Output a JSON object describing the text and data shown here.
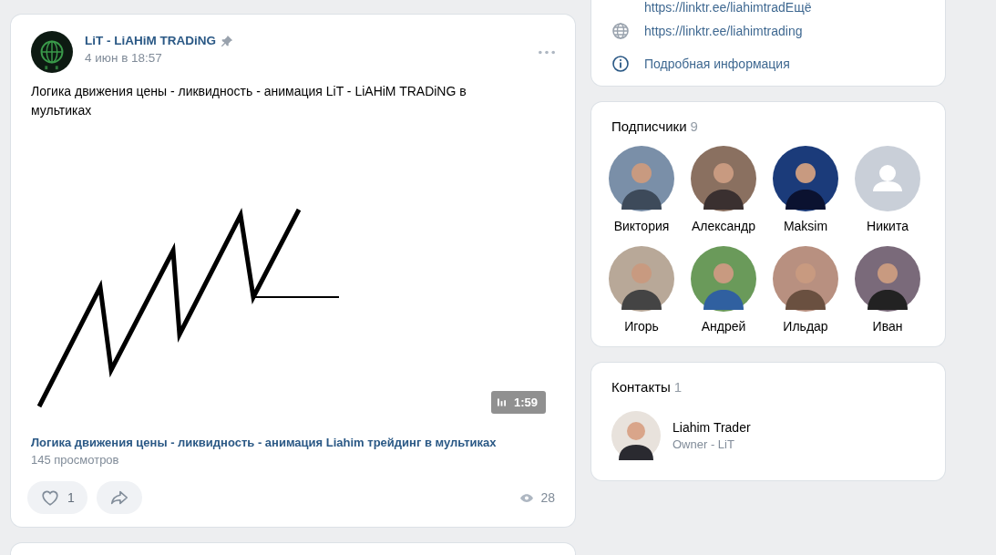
{
  "post": {
    "author": "LiT - LiAHiM TRADiNG",
    "pinned": true,
    "date": "4 июн в 18:57",
    "text": "Логика движения цены - ликвидность - анимация LiT - LiAHiM TRADiNG в мультиках",
    "video": {
      "kind": "picture",
      "duration": "1:59",
      "title": "Логика движения цены - ликвидность - анимация Liahim трейдинг в мультиках",
      "views": "145 просмотров"
    },
    "likes": {
      "count": "1",
      "liked": false
    },
    "view_count": "28"
  },
  "info": {
    "links": [
      {
        "kind": "partial",
        "text": "https://linktr.ee/liahimtradЕщё"
      },
      {
        "kind": "globe",
        "text": "https://linktr.ee/liahimtrading"
      },
      {
        "kind": "info",
        "text": "Подробная информация"
      }
    ]
  },
  "subscribers": {
    "title": "Подписчики",
    "count": "9",
    "people": [
      {
        "name": "Виктория"
      },
      {
        "name": "Александр"
      },
      {
        "name": "Maksim"
      },
      {
        "name": "Никита",
        "kind": "placeholder"
      },
      {
        "name": "Игорь"
      },
      {
        "name": "Андрей"
      },
      {
        "name": "Ильдар"
      },
      {
        "name": "Иван"
      }
    ]
  },
  "contacts": {
    "title": "Контакты",
    "count": "1",
    "people": [
      {
        "name": "Liahim Trader",
        "role": "Owner - LiT"
      }
    ]
  }
}
